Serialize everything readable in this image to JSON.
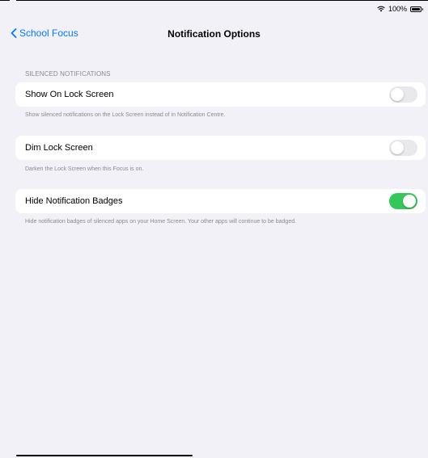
{
  "status_bar": {
    "battery_text": "100%"
  },
  "nav": {
    "back_label": "School Focus",
    "title": "Notification Options"
  },
  "section": {
    "header": "SILENCED NOTIFICATIONS"
  },
  "rows": [
    {
      "label": "Show On Lock Screen",
      "enabled": false,
      "footer": "Show silenced notifications on the Lock Screen instead of in Notification Centre."
    },
    {
      "label": "Dim Lock Screen",
      "enabled": false,
      "footer": "Darken the Lock Screen when this Focus is on."
    },
    {
      "label": "Hide Notification Badges",
      "enabled": true,
      "footer": "Hide notification badges of silenced apps on your Home Screen. Your other apps will continue to be badged."
    }
  ],
  "colors": {
    "accent": "#007aff",
    "toggle_on": "#34c759",
    "toggle_off": "#e9e9eb",
    "background": "#f2f1f7",
    "secondary_text": "#8a8a8e"
  },
  "icons": {
    "wifi": "wifi-icon",
    "battery": "battery-icon",
    "back": "chevron-left-icon"
  }
}
